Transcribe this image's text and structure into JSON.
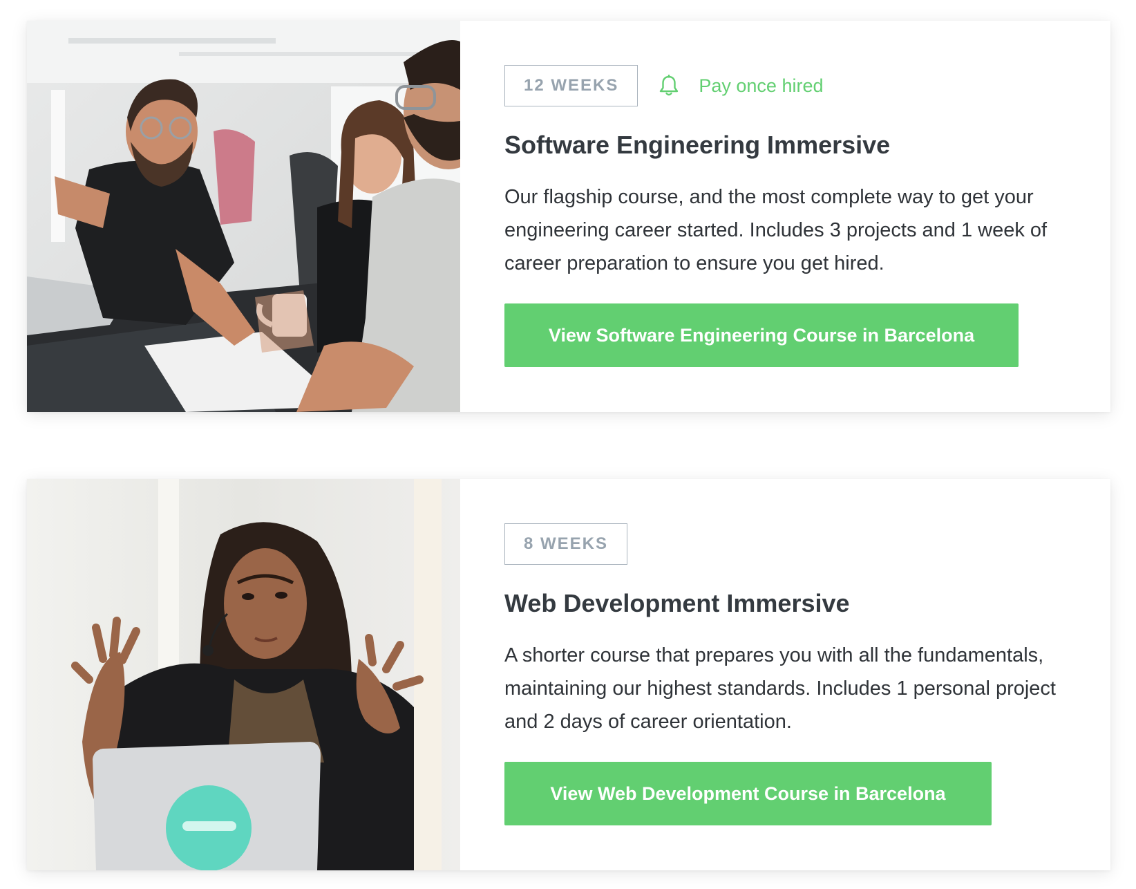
{
  "courses": [
    {
      "duration": "12 WEEKS",
      "pay_label": "Pay once hired",
      "title": "Software Engineering Immersive",
      "description": "Our flagship course, and the most complete way to get your engineering career started. Includes 3 projects and 1 week of career preparation to ensure you get hired.",
      "cta": "View Software Engineering Course in Barcelona",
      "photo_icon": "classroom-students-photo"
    },
    {
      "duration": "8 WEEKS",
      "title": "Web Development Immersive",
      "description": "A shorter course that prepares you with all the fundamentals, maintaining our highest standards. Includes 1 personal project and 2 days of career orientation.",
      "cta": "View Web Development Course in Barcelona",
      "photo_icon": "instructor-speaking-photo"
    }
  ],
  "colors": {
    "accent_green": "#62cf71",
    "badge_border": "#a9b3bd",
    "badge_text": "#97a3ae",
    "title_text": "#343a40",
    "body_text": "#2f3338"
  },
  "icons": {
    "pay": "bell-icon"
  }
}
